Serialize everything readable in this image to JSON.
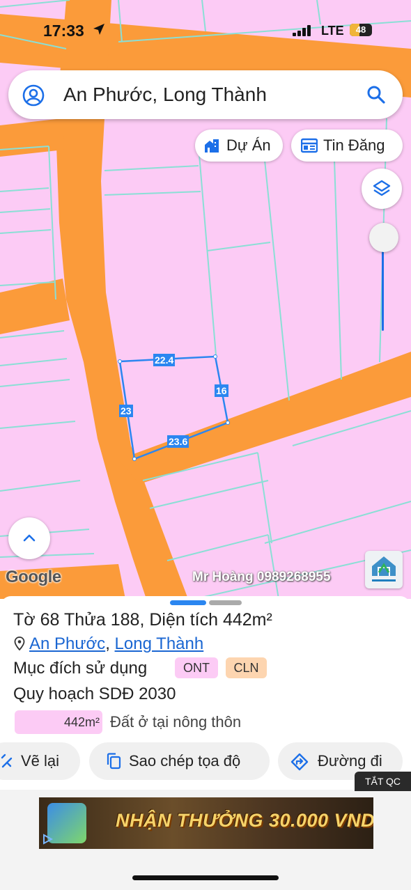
{
  "status_bar": {
    "time": "17:33",
    "network": "LTE",
    "battery": "48"
  },
  "search": {
    "query": "An Phước, Long Thành"
  },
  "map_buttons": {
    "project_label": "Dự Án",
    "listing_label": "Tin Đăng"
  },
  "parcel": {
    "edges": [
      "22.4",
      "16",
      "23.6",
      "23"
    ]
  },
  "map_overlay": {
    "google_label": "Google",
    "watermark": "Mr Hoàng 0989268955"
  },
  "info": {
    "sheet_label": "Tờ",
    "sheet_no": "68",
    "parcel_label": "Thửa",
    "parcel_no": "188",
    "area_label": "Diện tích",
    "area_value": "442m²",
    "commune": "An Phước",
    "district": "Long Thành",
    "purpose_label": "Mục đích sử dụng",
    "tags": [
      "ONT",
      "CLN"
    ],
    "plan_label": "Quy hoạch SDĐ 2030",
    "plan_area": "442m²",
    "plan_type": "Đất ở tại nông thôn"
  },
  "actions": {
    "redraw": "Vẽ lại",
    "copy_coords": "Sao chép tọa độ",
    "directions": "Đường đi"
  },
  "ad": {
    "close_label": "TẮT QC",
    "banner_text": "NHẬN THƯỞNG 30.000 VND"
  },
  "colors": {
    "land_pink": "#fccbf5",
    "road_orange": "#fb9b3a",
    "parcel_line": "#8adfd5",
    "accent_blue": "#2b86f0",
    "tag_ont": "#fccbf5",
    "tag_cln": "#fdd5b0"
  }
}
